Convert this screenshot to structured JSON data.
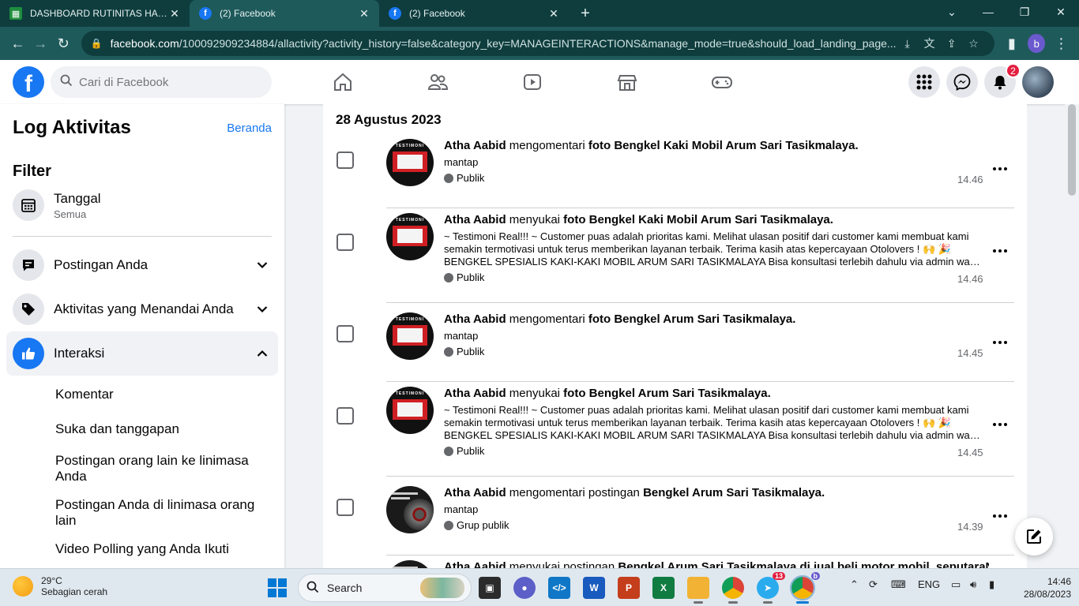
{
  "browser": {
    "tabs": [
      {
        "title": "DASHBOARD RUTINITAS HARIAN",
        "icon": "sheets-icon"
      },
      {
        "title": "(2) Facebook",
        "icon": "facebook-icon"
      },
      {
        "title": "(2) Facebook",
        "icon": "facebook-icon"
      }
    ],
    "url_host": "facebook.com",
    "url_path": "/100092909234884/allactivity?activity_history=false&category_key=MANAGEINTERACTIONS&manage_mode=true&should_load_landing_page...",
    "profile_initial": "b"
  },
  "fb": {
    "search_placeholder": "Cari di Facebook",
    "notif_count": "2"
  },
  "sidebar": {
    "title": "Log Aktivitas",
    "home_link": "Beranda",
    "filter_title": "Filter",
    "date_filter": {
      "label": "Tanggal",
      "value": "Semua"
    },
    "sections": [
      {
        "label": "Postingan Anda"
      },
      {
        "label": "Aktivitas yang Menandai Anda"
      },
      {
        "label": "Interaksi"
      }
    ],
    "sublinks": [
      "Komentar",
      "Suka dan tanggapan",
      "Postingan orang lain ke linimasa Anda",
      "Postingan Anda di linimasa orang lain",
      "Video Polling yang Anda Ikuti"
    ]
  },
  "main": {
    "date_header": "28 Agustus 2023",
    "items": [
      {
        "actor": "Atha Aabid",
        "verb": "mengomentari",
        "obj_type": "foto",
        "obj_type_bold": true,
        "target": "Bengkel Kaki Mobil Arum Sari Tasikmalaya",
        "text": [
          "mantap"
        ],
        "privacy": "Publik",
        "time": "14.46",
        "thumb": "testimoni"
      },
      {
        "actor": "Atha Aabid",
        "verb": "menyukai",
        "obj_type": "foto",
        "obj_type_bold": true,
        "target": "Bengkel Kaki Mobil Arum Sari Tasikmalaya",
        "text": [
          "~ Testimoni Real!!! ~ Customer puas adalah prioritas kami. Melihat ulasan positif dari customer kami membuat kami",
          "semakin termotivasi untuk terus memberikan layanan terbaik. Terima kasih atas kepercayaan Otolovers ! 🙌 🎉",
          "BENGKEL SPESIALIS KAKI-KAKI MOBIL ARUM SARI TASIKMALAYA Bisa konsultasi terlebih dahulu via admin wa bengkel"
        ],
        "privacy": "Publik",
        "time": "14.46",
        "thumb": "testimoni"
      },
      {
        "actor": "Atha Aabid",
        "verb": "mengomentari",
        "obj_type": "foto",
        "obj_type_bold": true,
        "target": "Bengkel Arum Sari Tasikmalaya",
        "text": [
          "mantap"
        ],
        "privacy": "Publik",
        "time": "14.45",
        "thumb": "testimoni"
      },
      {
        "actor": "Atha Aabid",
        "verb": "menyukai",
        "obj_type": "foto",
        "obj_type_bold": true,
        "target": "Bengkel Arum Sari Tasikmalaya",
        "text": [
          "~ Testimoni Real!!! ~ Customer puas adalah prioritas kami. Melihat ulasan positif dari customer kami membuat kami",
          "semakin termotivasi untuk terus memberikan layanan terbaik. Terima kasih atas kepercayaan Otolovers ! 🙌 🎉",
          "BENGKEL SPESIALIS KAKI-KAKI MOBIL ARUM SARI TASIKMALAYA Bisa konsultasi terlebih dahulu via admin wa bengkel"
        ],
        "privacy": "Publik",
        "time": "14.45",
        "thumb": "testimoni"
      },
      {
        "actor": "Atha Aabid",
        "verb": "mengomentari",
        "obj_type": "postingan",
        "obj_type_bold": false,
        "target": "Bengkel Arum Sari Tasikmalaya",
        "text": [
          "mantap"
        ],
        "privacy": "Grup publik",
        "time": "14.39",
        "thumb": "disc"
      },
      {
        "actor": "Atha Aabid",
        "verb": "menyukai",
        "obj_type": "postingan",
        "obj_type_bold": false,
        "target": "Bengkel Arum Sari Tasikmalaya di jual beli motor mobil, seputaraN",
        "text": [],
        "privacy": "",
        "time": "",
        "thumb": "disc"
      }
    ],
    "testimoni_label": "TESTIMONI"
  },
  "taskbar": {
    "weather_temp": "29°C",
    "weather_desc": "Sebagian cerah",
    "search_label": "Search",
    "lang": "ENG",
    "time": "14:46",
    "date": "28/08/2023",
    "telegram_badge": "13",
    "chrome_profile": "b"
  }
}
